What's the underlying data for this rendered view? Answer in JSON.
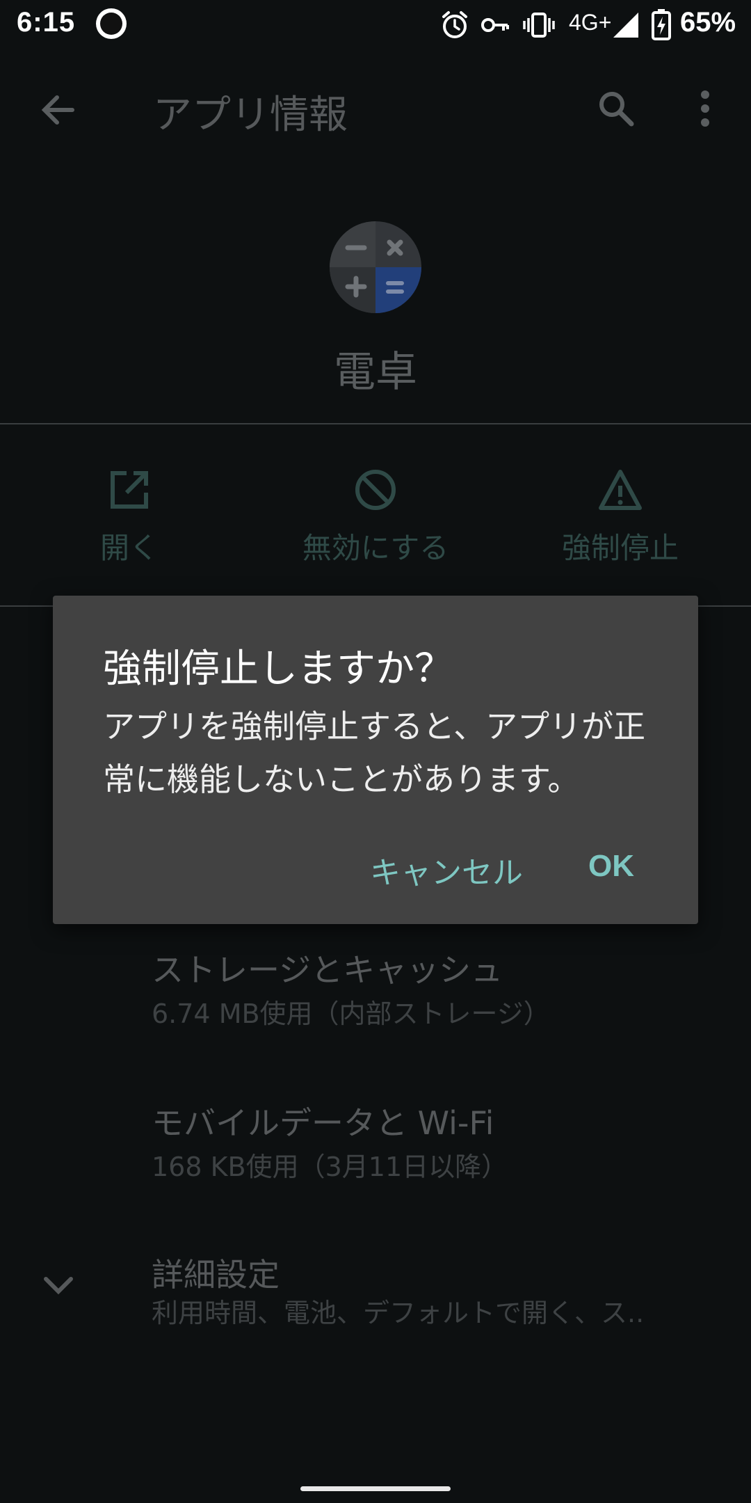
{
  "status_bar": {
    "time": "6:15",
    "network": "4G+",
    "battery": "65%"
  },
  "app_bar": {
    "title": "アプリ情報",
    "icons": [
      "back-arrow-icon",
      "search-icon",
      "more-vert-icon"
    ]
  },
  "app": {
    "name": "電卓",
    "icon": "calculator-icon",
    "colors": {
      "gray": "#3a3d3f",
      "blue": "#223f7a"
    }
  },
  "actions": [
    {
      "label": "開く",
      "icon": "open-external-icon"
    },
    {
      "label": "無効にする",
      "icon": "disable-icon"
    },
    {
      "label": "強制停止",
      "icon": "warning-icon"
    }
  ],
  "settings": [
    {
      "title": "ストレージとキャッシュ",
      "subtitle": "6.74 MB使用（内部ストレージ）"
    },
    {
      "title": "モバイルデータと Wi-Fi",
      "subtitle": "168 KB使用（3月11日以降）"
    },
    {
      "title": "詳細設定",
      "subtitle": "利用時間、電池、デフォルトで開く、ス.."
    }
  ],
  "dialog": {
    "title": "強制停止しますか？",
    "message": "アプリを強制停止すると、アプリが正常に機能しないことがあります。",
    "cancel_label": "キャンセル",
    "ok_label": "OK",
    "accent": "#7ec7c2",
    "background": "#424242"
  }
}
